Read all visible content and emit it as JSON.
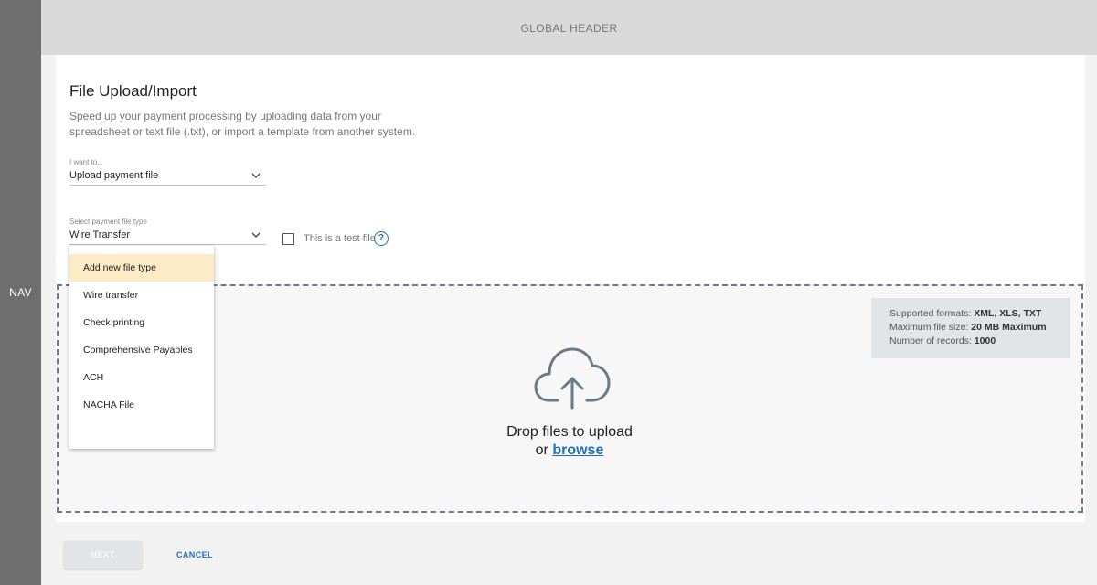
{
  "nav": {
    "label": "NAV"
  },
  "header": {
    "label": "GLOBAL HEADER"
  },
  "page": {
    "title": "File Upload/Import",
    "description": "Speed up your payment processing by uploading data from your spreadsheet or text file (.txt), or import a template from another system."
  },
  "action_field": {
    "label": "I want to...",
    "value": "Upload payment file"
  },
  "file_type_field": {
    "label": "Select payment file type",
    "value": "Wire Transfer"
  },
  "test_file": {
    "label": "This is a test file",
    "checked": false
  },
  "help_icon": {
    "glyph": "?"
  },
  "dropdown": {
    "items": [
      "Add new file type",
      "Wire transfer",
      "Check printing",
      "Comprehensive Payables",
      "ACH",
      "NACHA File"
    ]
  },
  "info": {
    "formats_label": "Supported formats:",
    "formats_value": "XML, XLS, TXT",
    "size_label": "Maximum file size:",
    "size_value": "20 MB Maximum",
    "records_label": "Number of records:",
    "records_value": "1000"
  },
  "dropzone": {
    "line1": "Drop files to upload",
    "or_text": "or",
    "browse_label": "browse"
  },
  "buttons": {
    "next_label": "NEXT",
    "cancel_label": "CANCEL"
  },
  "colors": {
    "accent": "#1f6fb8",
    "highlight": "#fdebc8",
    "nav": "#6e6e6e",
    "header": "#d9d9d9"
  }
}
